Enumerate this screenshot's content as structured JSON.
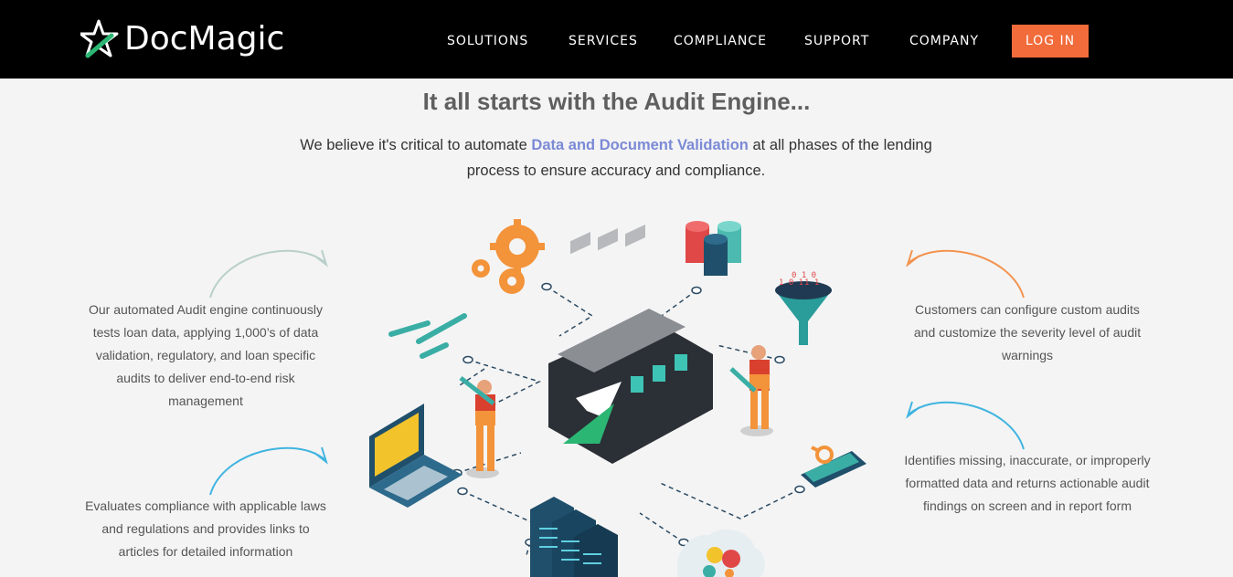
{
  "nav": {
    "brand": "DocMagic",
    "items": [
      "SOLUTIONS",
      "SERVICES",
      "COMPLIANCE",
      "SUPPORT",
      "COMPANY"
    ],
    "login_label": "LOG IN"
  },
  "hero": {
    "title": "It all starts with the Audit Engine...",
    "intro_before": "We believe it's critical to automate ",
    "intro_highlight": "Data and Document Validation",
    "intro_after": " at all phases of the lending process to ensure accuracy and compliance."
  },
  "features": {
    "left_top": "Our automated Audit engine continuously tests loan data, applying 1,000’s of data validation, regulatory, and loan specific audits to deliver end-to-end risk management",
    "left_bottom": "Evaluates compliance with applicable laws and regulations and provides links to articles for detailed information",
    "right_top": "Customers can configure custom audits and customize the severity level of audit warnings",
    "right_bottom": "Identifies missing, inaccurate, or improperly formatted data and returns actionable audit findings on screen and in report form"
  },
  "colors": {
    "login_bg": "#f26b3a",
    "highlight": "#7b8ad6",
    "arrow_grey": "#b9cfc9",
    "arrow_blue": "#3fb4e0",
    "arrow_orange": "#f3934f"
  },
  "icons": [
    "star-check-logo-icon",
    "gears-icon",
    "database-icon",
    "wrenches-icon",
    "data-funnel-icon",
    "laptop-binary-icon",
    "tablet-magnifier-icon",
    "server-rack-icon",
    "cloud-gears-icon",
    "engine-icon"
  ]
}
